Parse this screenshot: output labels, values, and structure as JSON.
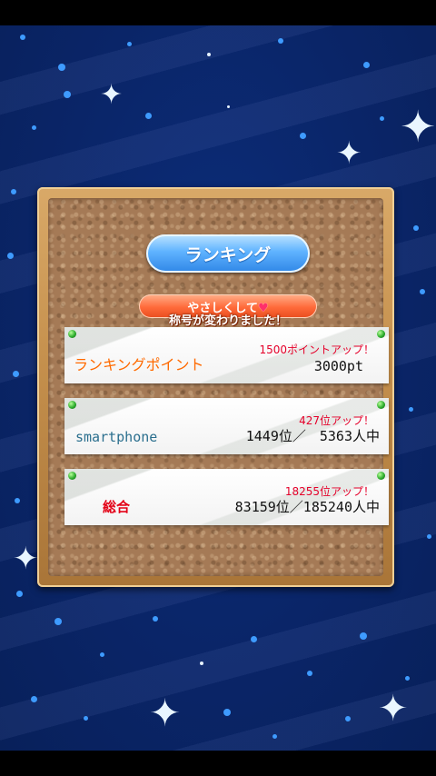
{
  "title": "ランキング",
  "notice": {
    "name": "やさしくして",
    "message": "称号が変わりました！"
  },
  "cards": [
    {
      "label": "ランキングポイント",
      "up": "1500ポイントアップ！",
      "value": "3000pt"
    },
    {
      "label": "smartphone",
      "up": "427位アップ！",
      "value": "1449位／　5363人中"
    },
    {
      "label": "総合",
      "up": "18255位アップ！",
      "value": "83159位／185240人中"
    }
  ],
  "colors": {
    "label_orange": "#ff6a00",
    "label_teal": "#2b6f8e",
    "label_red": "#e30016",
    "up_red": "#e5002a"
  }
}
